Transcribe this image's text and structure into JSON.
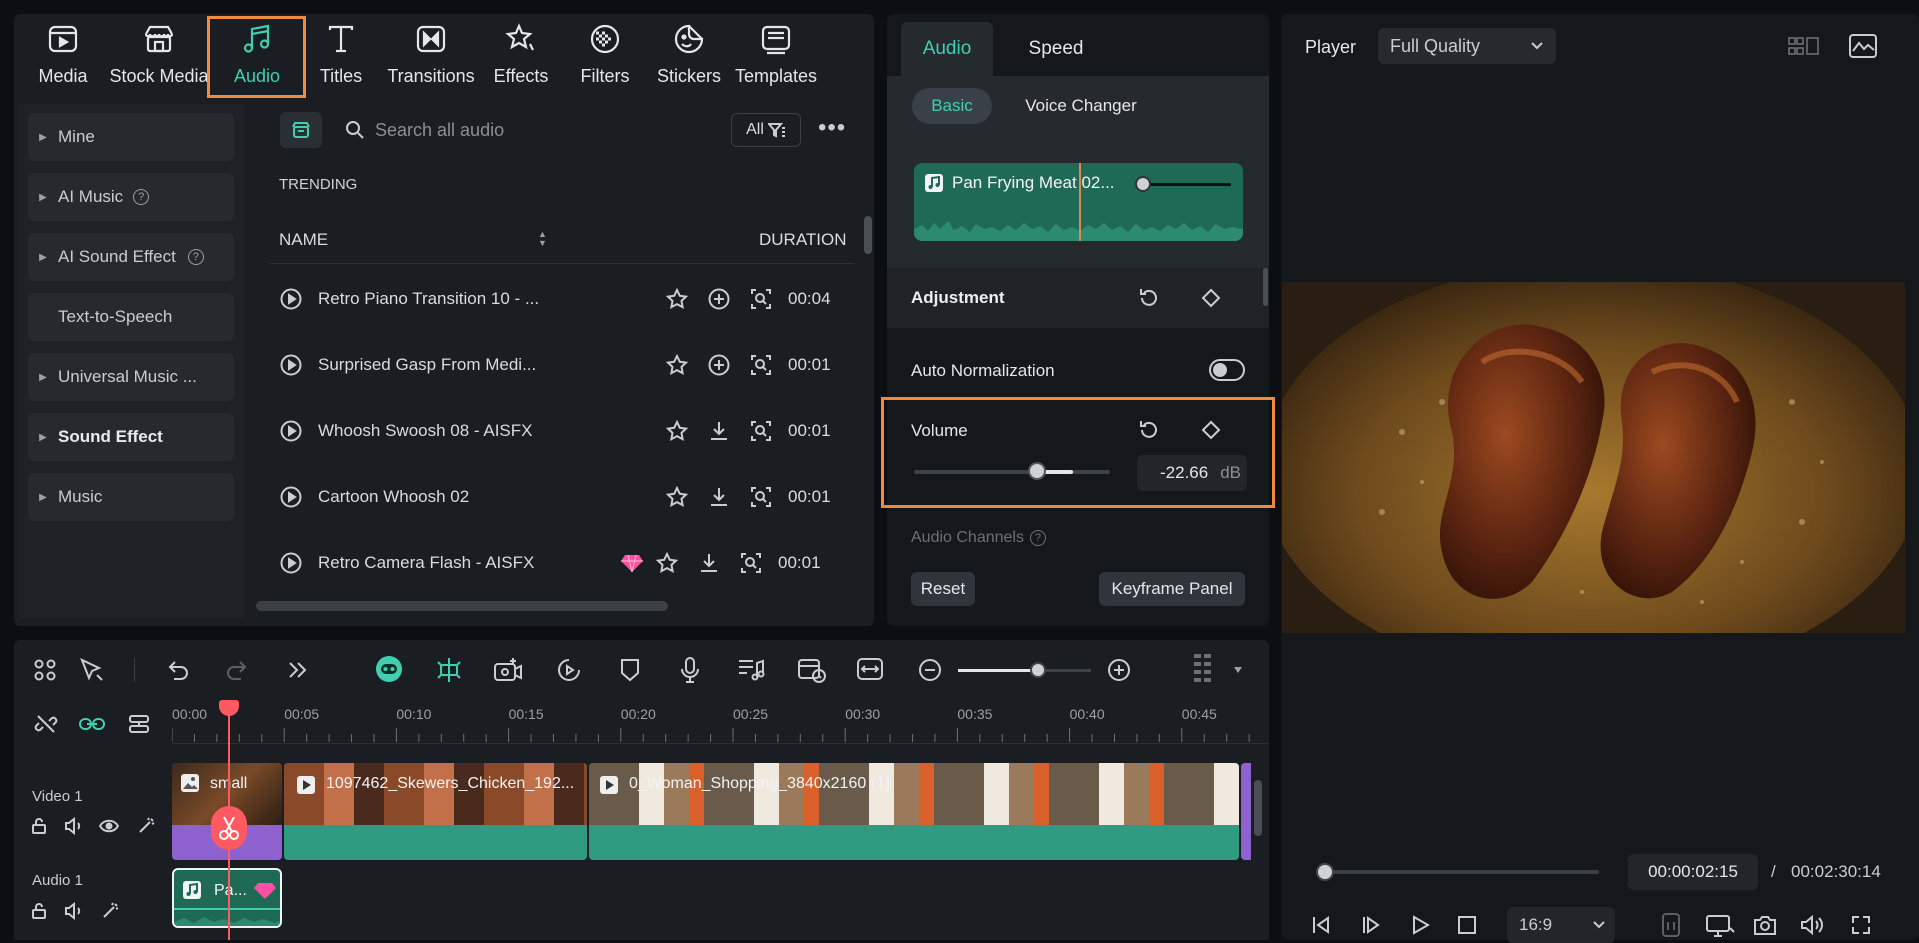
{
  "toolbar": {
    "tabs": [
      {
        "label": "Media",
        "icon": "media-icon"
      },
      {
        "label": "Stock Media",
        "icon": "stock-media-icon"
      },
      {
        "label": "Audio",
        "icon": "music-note-icon"
      },
      {
        "label": "Titles",
        "icon": "titles-icon"
      },
      {
        "label": "Transitions",
        "icon": "transitions-icon"
      },
      {
        "label": "Effects",
        "icon": "effects-icon"
      },
      {
        "label": "Filters",
        "icon": "filters-icon"
      },
      {
        "label": "Stickers",
        "icon": "stickers-icon"
      },
      {
        "label": "Templates",
        "icon": "templates-icon"
      }
    ],
    "active": "Audio"
  },
  "sidebar": {
    "items": [
      {
        "label": "Mine",
        "arrow": true
      },
      {
        "label": "AI Music",
        "arrow": true,
        "help": true
      },
      {
        "label": "AI Sound Effect",
        "arrow": true,
        "help": true
      },
      {
        "label": "Text-to-Speech",
        "arrow": false
      },
      {
        "label": "Universal Music ...",
        "arrow": true
      },
      {
        "label": "Sound Effect",
        "arrow": true,
        "bold": true
      },
      {
        "label": "Music",
        "arrow": true
      }
    ]
  },
  "library": {
    "search_placeholder": "Search all audio",
    "filter_label": "All",
    "section": "TRENDING",
    "col_name": "NAME",
    "col_duration": "DURATION",
    "rows": [
      {
        "name": "Retro Piano Transition 10 - ...",
        "action": "add",
        "duration": "00:04",
        "premium": false
      },
      {
        "name": "Surprised Gasp From Medi...",
        "action": "add",
        "duration": "00:01",
        "premium": false
      },
      {
        "name": "Whoosh Swoosh 08 - AISFX",
        "action": "download",
        "duration": "00:01",
        "premium": false
      },
      {
        "name": "Cartoon Whoosh 02",
        "action": "download",
        "duration": "00:01",
        "premium": false
      },
      {
        "name": "Retro Camera Flash - AISFX",
        "action": "download",
        "duration": "00:01",
        "premium": true
      }
    ]
  },
  "props": {
    "tabs": [
      "Audio",
      "Speed"
    ],
    "subtabs": [
      "Basic",
      "Voice Changer"
    ],
    "clip_name": "Pan Frying Meat 02...",
    "adjustment": "Adjustment",
    "auto_normalization": "Auto Normalization",
    "volume_label": "Volume",
    "volume_value": "-22.66",
    "volume_unit": "dB",
    "volume_level": 0.63,
    "audio_channels": "Audio Channels",
    "reset": "Reset",
    "keyframe_panel": "Keyframe Panel"
  },
  "player": {
    "label": "Player",
    "quality": "Full Quality",
    "current_time": "00:00:02:15",
    "separator": "/",
    "total_time": "00:02:30:14",
    "aspect": "16:9",
    "progress": 0.02
  },
  "timeline": {
    "ticks": [
      "00:00",
      "00:05",
      "00:10",
      "00:15",
      "00:20",
      "00:25",
      "00:30",
      "00:35",
      "00:40",
      "00:45"
    ],
    "zoom_level": 0.6,
    "tracks": [
      {
        "label": "Video 1"
      },
      {
        "label": "Audio 1"
      }
    ],
    "clips": [
      {
        "name": "small"
      },
      {
        "name": "1097462_Skewers_Chicken_192..."
      },
      {
        "name": "0_Woman_Shopping_3840x2160 (1)"
      }
    ],
    "audio_clip": "Pa..."
  },
  "colors": {
    "accent": "#3fd0b0",
    "highlight": "#f08a3c",
    "playhead": "#ff5a62"
  }
}
